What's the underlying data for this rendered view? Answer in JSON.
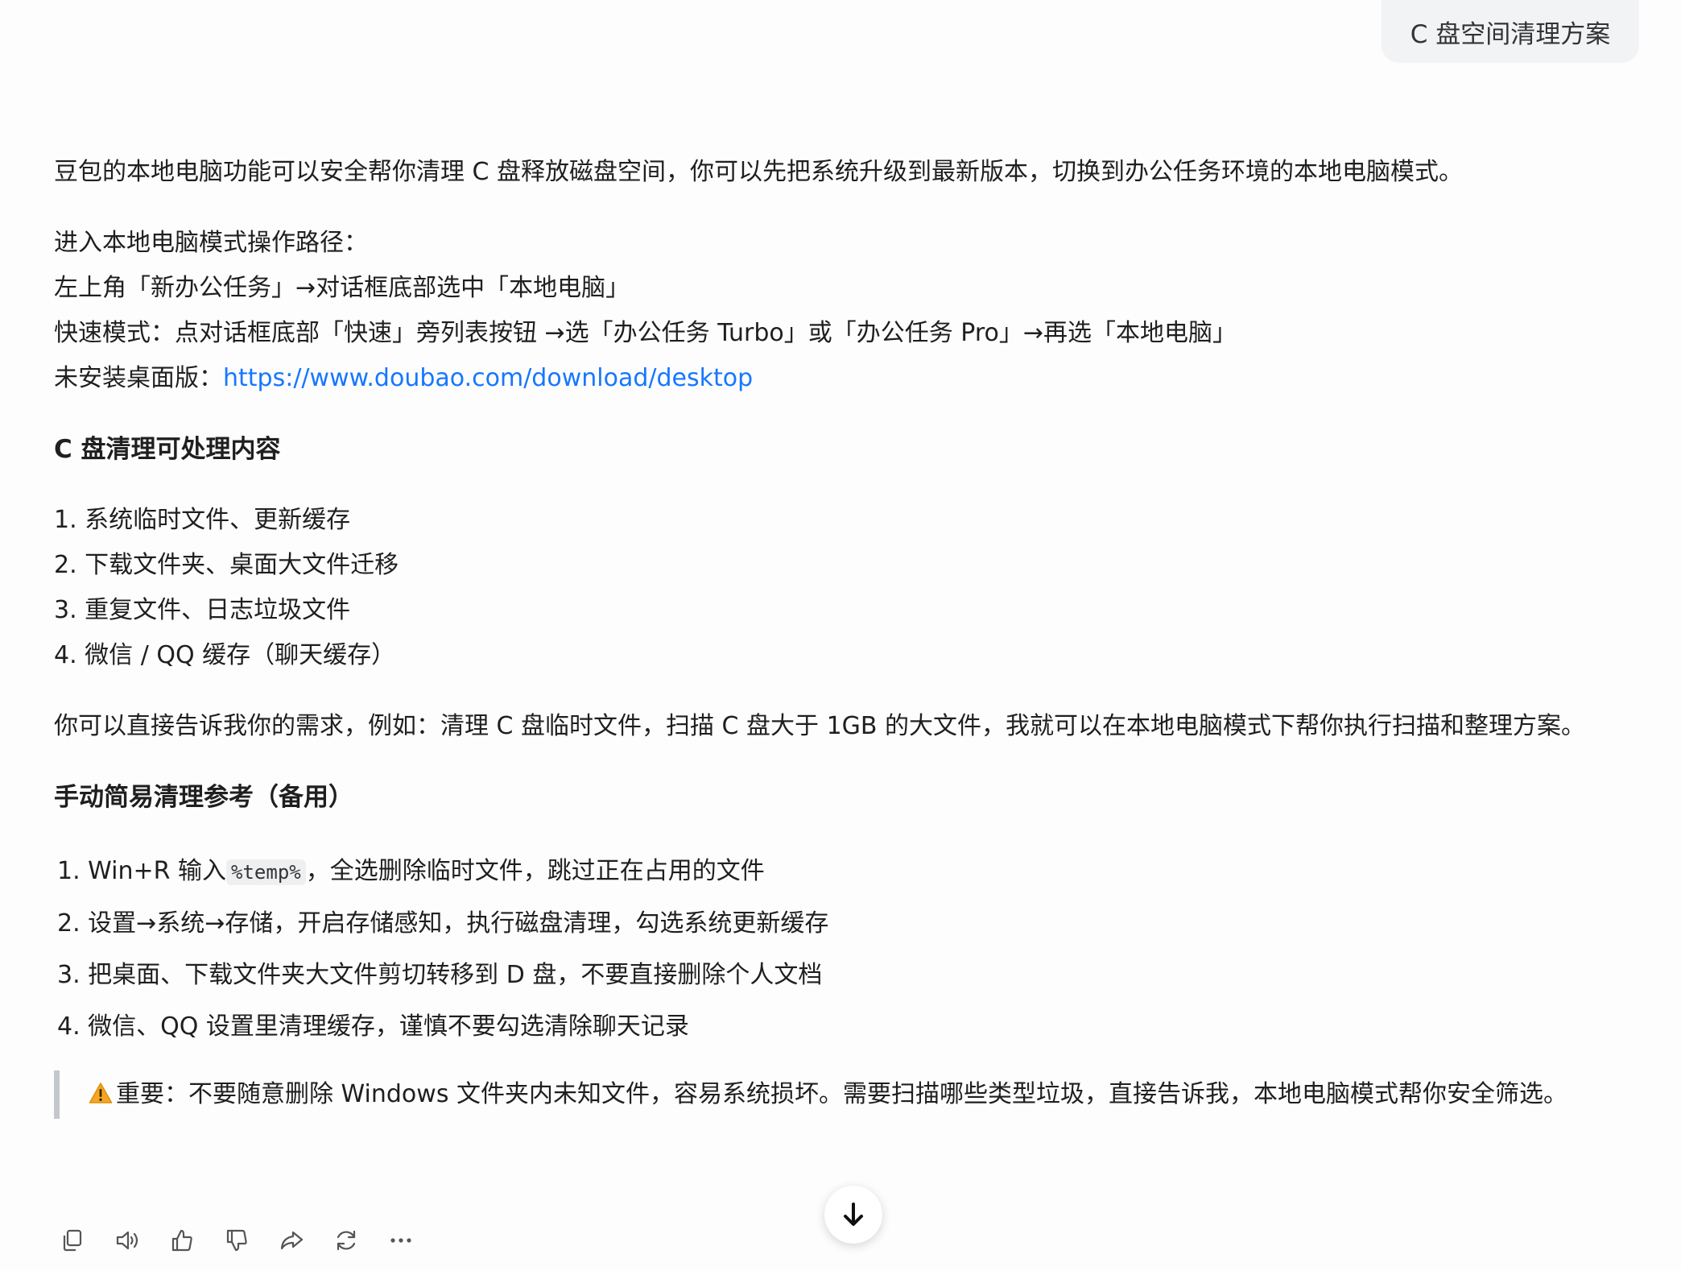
{
  "user_message": "C 盘空间清理方案",
  "reply": {
    "intro": "豆包的本地电脑功能可以安全帮你清理 C 盘释放磁盘空间，你可以先把系统升级到最新版本，切换到办公任务环境的本地电脑模式。",
    "route_title": "进入本地电脑模式操作路径：",
    "route_step1": "左上角「新办公任务」→对话框底部选中「本地电脑」",
    "route_step2": "快速模式：点对话框底部「快速」旁列表按钮 →选「办公任务 Turbo」或「办公任务 Pro」→再选「本地电脑」",
    "desktop_label": "未安装桌面版：",
    "desktop_link": "https://www.doubao.com/download/desktop",
    "section1_heading": "C 盘清理可处理内容",
    "section1_items": [
      "1. 系统临时文件、更新缓存",
      "2. 下载文件夹、桌面大文件迁移",
      "3. 重复文件、日志垃圾文件",
      "4. 微信 / QQ 缓存（聊天缓存）"
    ],
    "request_paragraph": "你可以直接告诉我你的需求，例如：清理 C 盘临时文件，扫描 C 盘大于 1GB 的大文件，我就可以在本地电脑模式下帮你执行扫描和整理方案。",
    "section2_heading": "手动简易清理参考（备用）",
    "manual_item1_prefix": "1. Win+R 输入",
    "manual_item1_code": "%temp%",
    "manual_item1_suffix": "，全选删除临时文件，跳过正在占用的文件",
    "manual_items_rest": [
      "2. 设置→系统→存储，开启存储感知，执行磁盘清理，勾选系统更新缓存",
      "3. 把桌面、下载文件夹大文件剪切转移到 D 盘，不要直接删除个人文档",
      "4. 微信、QQ 设置里清理缓存，谨慎不要勾选清除聊天记录"
    ],
    "warning": "重要：不要随意删除 Windows 文件夹内未知文件，容易系统损坏。需要扫描哪些类型垃圾，直接告诉我，本地电脑模式帮你安全筛选。"
  },
  "colors": {
    "link": "#1677ff",
    "bubble_bg": "#f2f3f5",
    "quote_border": "#c4c7cc",
    "warning_icon": "#f5a623"
  },
  "icons": {
    "actions": [
      "copy-icon",
      "speaker-icon",
      "thumbs-up-icon",
      "thumbs-down-icon",
      "share-icon",
      "regenerate-icon",
      "more-icon"
    ],
    "scroll": "arrow-down-icon",
    "warning": "warning-icon"
  }
}
